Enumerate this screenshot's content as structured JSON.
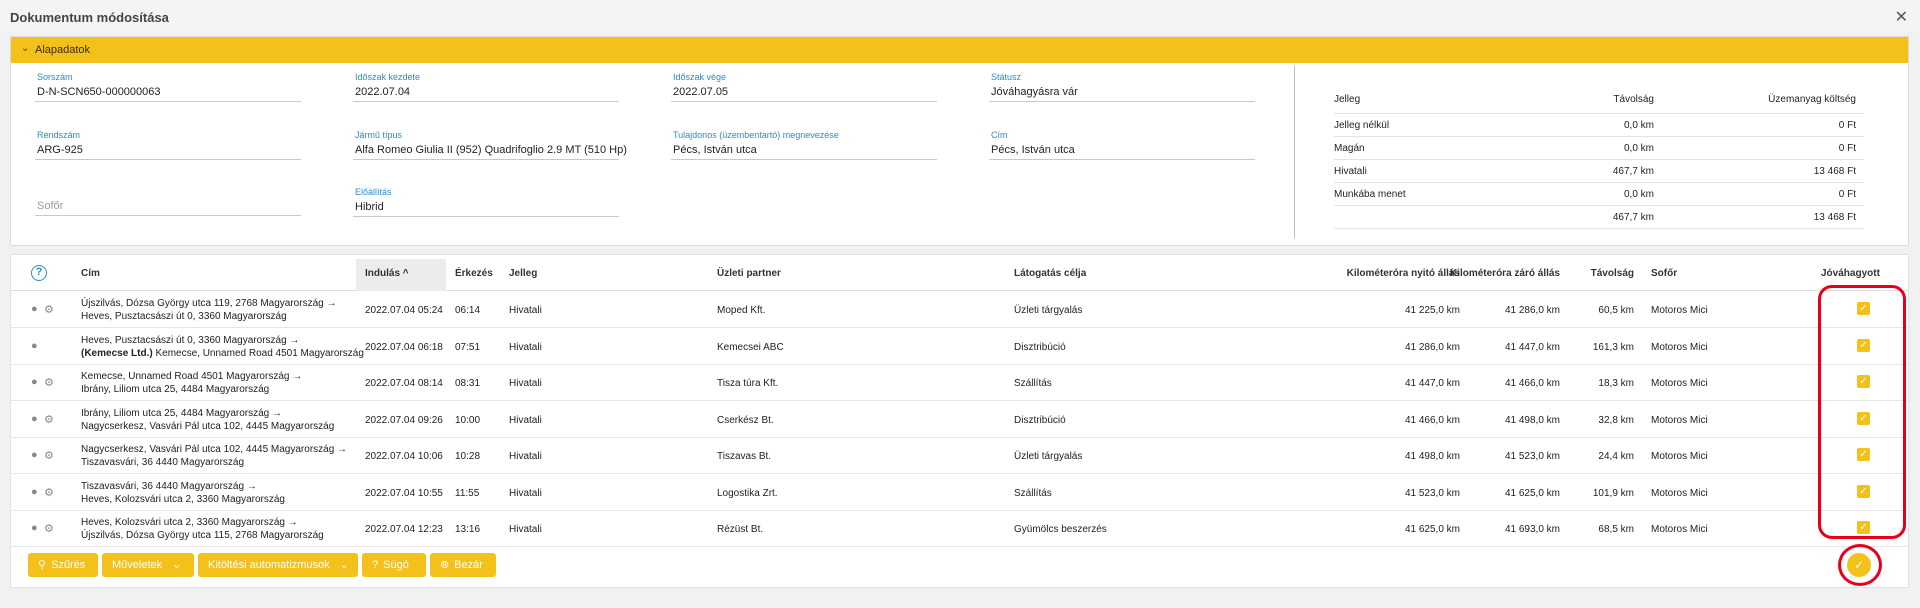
{
  "window": {
    "title": "Dokumentum módosítása",
    "close_icon": "close-icon"
  },
  "section": {
    "title": "Alapadatok"
  },
  "fields": {
    "sorszam": {
      "label": "Sorszám",
      "value": "D-N-SCN650-000000063"
    },
    "idoszak_kezdete": {
      "label": "Időszak kezdete",
      "value": "2022.07.04"
    },
    "idoszak_vege": {
      "label": "Időszak vége",
      "value": "2022.07.05"
    },
    "statusz": {
      "label": "Státusz",
      "value": "Jóváhagyásra vár"
    },
    "rendszam": {
      "label": "Rendszám",
      "value": "ARG-925"
    },
    "jarmu_tipus": {
      "label": "Jármű típus",
      "value": "Alfa Romeo Giulia II (952) Quadrifoglio 2.9 MT (510 Hp)"
    },
    "tulajdonos": {
      "label": "Tulajdonos (üzembentartó) megnevezése",
      "value": "Pécs, István utca"
    },
    "cim": {
      "label": "Cím",
      "value": "Pécs, István utca"
    },
    "sofor": {
      "placeholder": "Sofőr"
    },
    "eloallitas": {
      "label": "Előállítás",
      "value": "Hibrid"
    }
  },
  "summary": {
    "headers": [
      "Jelleg",
      "Távolság",
      "Üzemanyag költség"
    ],
    "rows": [
      [
        "Jelleg nélkül",
        "0,0 km",
        "0 Ft"
      ],
      [
        "Magán",
        "0,0 km",
        "0 Ft"
      ],
      [
        "Hivatali",
        "467,7 km",
        "13 468 Ft"
      ],
      [
        "Munkába menet",
        "0,0 km",
        "0 Ft"
      ],
      [
        "",
        "467,7 km",
        "13 468 Ft"
      ]
    ]
  },
  "table": {
    "headers": {
      "cim": "Cím",
      "indulas": "Indulás",
      "erkezes": "Érkezés",
      "jelleg": "Jelleg",
      "partner": "Üzleti partner",
      "cel": "Látogatás célja",
      "nyito": "Kilométeróra nyitó állás",
      "zaro": "Kilométeróra záró állás",
      "tavolsag": "Távolság",
      "sofor": "Sofőr",
      "jovahagyott": "Jóváhagyott"
    },
    "sort_indicator": "^",
    "rows": [
      {
        "line1": "Újszilvás, Dózsa György utca 119, 2768 Magyarország →",
        "line2_bold": "",
        "line2": "Heves, Pusztacsászi út 0, 3360 Magyarország",
        "indulas": "2022.07.04 05:24",
        "erkezes": "06:14",
        "jelleg": "Hivatali",
        "partner": "Moped Kft.",
        "cel": "Üzleti tárgyalás",
        "nyito": "41 225,0 km",
        "zaro": "41 286,0 km",
        "tavolsag": "60,5 km",
        "sofor": "Motoros Mici",
        "gear": true
      },
      {
        "line1": "Heves, Pusztacsászi út 0, 3360 Magyarország →",
        "line2_bold": "(Kemecse Ltd.)",
        "line2": " Kemecse, Unnamed Road 4501 Magyarország",
        "indulas": "2022.07.04 06:18",
        "erkezes": "07:51",
        "jelleg": "Hivatali",
        "partner": "Kemecsei ABC",
        "cel": "Disztribúció",
        "nyito": "41 286,0 km",
        "zaro": "41 447,0 km",
        "tavolsag": "161,3 km",
        "sofor": "Motoros Mici",
        "gear": false
      },
      {
        "line1": "Kemecse, Unnamed Road 4501 Magyarország →",
        "line2_bold": "",
        "line2": "Ibrány, Liliom utca 25, 4484 Magyarország",
        "indulas": "2022.07.04 08:14",
        "erkezes": "08:31",
        "jelleg": "Hivatali",
        "partner": "Tisza túra Kft.",
        "cel": "Szállítás",
        "nyito": "41 447,0 km",
        "zaro": "41 466,0 km",
        "tavolsag": "18,3 km",
        "sofor": "Motoros Mici",
        "gear": true
      },
      {
        "line1": "Ibrány, Liliom utca 25, 4484 Magyarország →",
        "line2_bold": "",
        "line2": "Nagycserkesz, Vasvári Pál utca 102, 4445 Magyarország",
        "indulas": "2022.07.04 09:26",
        "erkezes": "10:00",
        "jelleg": "Hivatali",
        "partner": "Cserkész Bt.",
        "cel": "Disztribúció",
        "nyito": "41 466,0 km",
        "zaro": "41 498,0 km",
        "tavolsag": "32,8 km",
        "sofor": "Motoros Mici",
        "gear": true
      },
      {
        "line1": "Nagycserkesz, Vasvári Pál utca 102, 4445 Magyarország →",
        "line2_bold": "",
        "line2": "Tiszavasvári, 36 4440 Magyarország",
        "indulas": "2022.07.04 10:06",
        "erkezes": "10:28",
        "jelleg": "Hivatali",
        "partner": "Tiszavas Bt.",
        "cel": "Üzleti tárgyalás",
        "nyito": "41 498,0 km",
        "zaro": "41 523,0 km",
        "tavolsag": "24,4 km",
        "sofor": "Motoros Mici",
        "gear": true
      },
      {
        "line1": "Tiszavasvári, 36 4440 Magyarország →",
        "line2_bold": "",
        "line2": "Heves, Kolozsvári utca 2, 3360 Magyarország",
        "indulas": "2022.07.04 10:55",
        "erkezes": "11:55",
        "jelleg": "Hivatali",
        "partner": "Logostika Zrt.",
        "cel": "Szállítás",
        "nyito": "41 523,0 km",
        "zaro": "41 625,0 km",
        "tavolsag": "101,9 km",
        "sofor": "Motoros Mici",
        "gear": true
      },
      {
        "line1": "Heves, Kolozsvári utca 2, 3360 Magyarország →",
        "line2_bold": "",
        "line2": "Újszilvás, Dózsa György utca 115, 2768 Magyarország",
        "indulas": "2022.07.04 12:23",
        "erkezes": "13:16",
        "jelleg": "Hivatali",
        "partner": "Rézüst Bt.",
        "cel": "Gyümölcs beszerzés",
        "nyito": "41 625,0 km",
        "zaro": "41 693,0 km",
        "tavolsag": "68,5 km",
        "sofor": "Motoros Mici",
        "gear": true
      }
    ]
  },
  "toolbar": {
    "szures": "Szűrés",
    "muveletek": "Műveletek",
    "kitoltesi": "Kitöltési automatizmusok",
    "sugo": "Súgó",
    "bezar": "Bezár"
  },
  "colors": {
    "accent": "#f4c01a",
    "highlight": "#e8001a",
    "label": "#2a8ccf"
  }
}
